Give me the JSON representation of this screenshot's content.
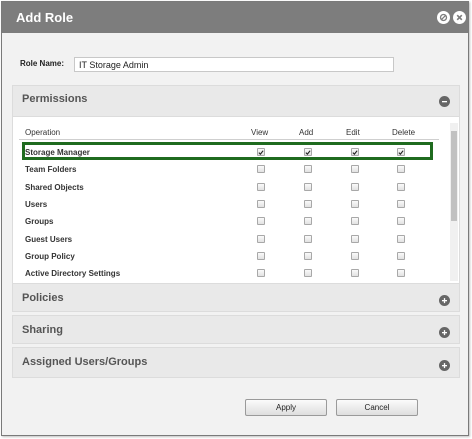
{
  "dialog": {
    "title": "Add Role",
    "role_name_label": "Role Name:",
    "role_name_value": "IT Storage Admin"
  },
  "permissions": {
    "title": "Permissions",
    "columns": [
      "Operation",
      "View",
      "Add",
      "Edit",
      "Delete"
    ],
    "rows": [
      {
        "name": "Storage Manager",
        "checked": [
          true,
          true,
          true,
          true
        ],
        "highlighted": true
      },
      {
        "name": "Team Folders",
        "checked": [
          false,
          false,
          false,
          false
        ]
      },
      {
        "name": "Shared Objects",
        "checked": [
          false,
          false,
          false,
          false
        ]
      },
      {
        "name": "Users",
        "checked": [
          false,
          false,
          false,
          false
        ]
      },
      {
        "name": "Groups",
        "checked": [
          false,
          false,
          false,
          false
        ]
      },
      {
        "name": "Guest Users",
        "checked": [
          false,
          false,
          false,
          false
        ]
      },
      {
        "name": "Group Policy",
        "checked": [
          false,
          false,
          false,
          false
        ]
      },
      {
        "name": "Active Directory Settings",
        "checked": [
          false,
          false,
          false,
          false
        ]
      }
    ]
  },
  "sections": [
    {
      "title": "Policies"
    },
    {
      "title": "Sharing"
    },
    {
      "title": "Assigned Users/Groups"
    }
  ],
  "buttons": {
    "apply": "Apply",
    "cancel": "Cancel"
  },
  "colors": {
    "titlebar": "#7d7d7d",
    "highlight": "#1f6b1f",
    "section_bg": "#e9e9e9",
    "toggle_icon": "#666666"
  },
  "icons": {
    "close": "close-circle-icon",
    "minimize": "stop-circle-icon",
    "collapse": "minus-circle-icon",
    "expand": "plus-circle-icon",
    "checkmark": "checkmark-icon"
  }
}
